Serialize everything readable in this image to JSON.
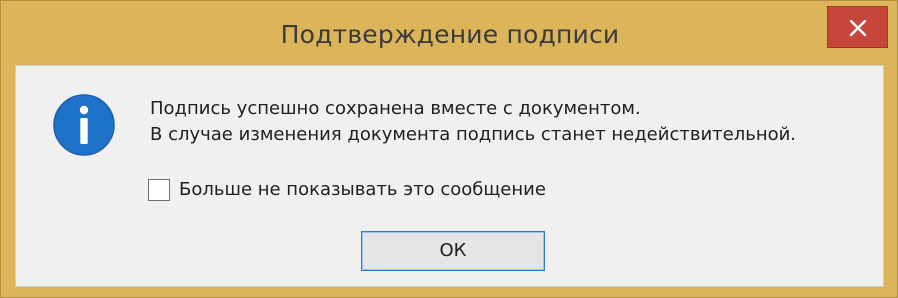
{
  "window": {
    "title": "Подтверждение подписи",
    "close_icon": "close-icon"
  },
  "dialog": {
    "icon": "info-icon",
    "message_lines": [
      "Подпись успешно сохранена вместе с документом.",
      "В случае изменения документа подпись станет недействительной."
    ],
    "checkbox": {
      "label": "Больше не показывать это сообщение",
      "checked": false
    },
    "ok_label": "ОК"
  },
  "colors": {
    "titlebar": "#dcb55a",
    "close_button": "#c7463c",
    "client_background": "#f0f0f0",
    "info_icon": "#1e73c8",
    "ok_border": "#2d7bd0"
  }
}
